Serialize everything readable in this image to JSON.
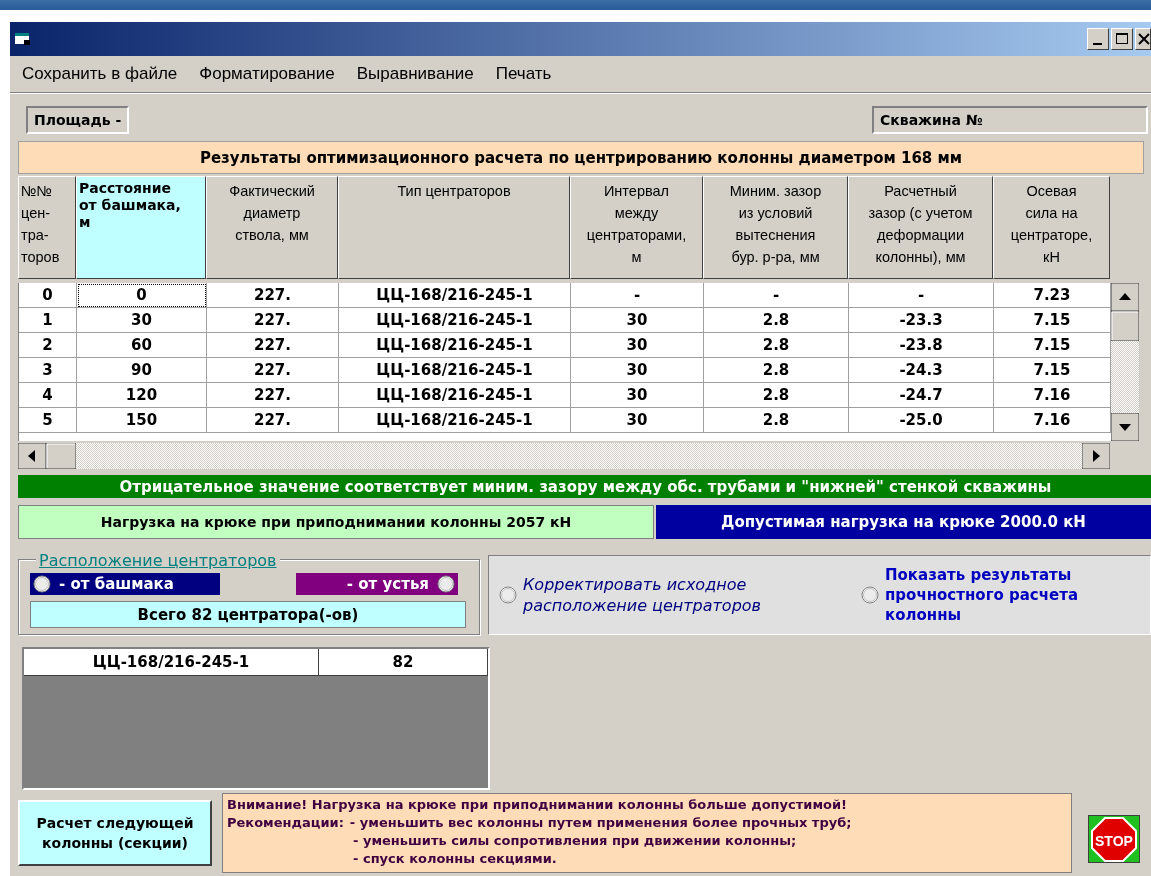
{
  "menu": [
    "Сохранить в файле",
    "Форматирование",
    "Выравнивание",
    "Печать"
  ],
  "fields": {
    "area": "Площадь -",
    "well": "Скважина №"
  },
  "results_title": "Результаты оптимизационного расчета по центрированию колонны диаметром  168 мм",
  "table": {
    "columns": [
      {
        "label": "№№\nцен-\nтра-\nторов",
        "selected": false
      },
      {
        "label": "Расстояние\nот башмака,\nм",
        "selected": true
      },
      {
        "label": "Фактический\nдиаметр\nствола, мм",
        "selected": false
      },
      {
        "label": "Тип центраторов",
        "selected": false
      },
      {
        "label": "Интервал\nмежду\nцентраторами,\nм",
        "selected": false
      },
      {
        "label": "Миним. зазор\nиз условий\nвытеснения\nбур. р-ра, мм",
        "selected": false
      },
      {
        "label": "Расчетный\nзазор (с учетом\nдеформации\nколонны), мм",
        "selected": false
      },
      {
        "label": "Осевая\nсила на\nцентраторе,\nкН",
        "selected": false
      }
    ],
    "rows": [
      [
        "0",
        "0",
        "227.",
        "ЦЦ-168/216-245-1",
        "-",
        "-",
        "-",
        "7.23"
      ],
      [
        "1",
        "30",
        "227.",
        "ЦЦ-168/216-245-1",
        "30",
        "2.8",
        "-23.3",
        "7.15"
      ],
      [
        "2",
        "60",
        "227.",
        "ЦЦ-168/216-245-1",
        "30",
        "2.8",
        "-23.8",
        "7.15"
      ],
      [
        "3",
        "90",
        "227.",
        "ЦЦ-168/216-245-1",
        "30",
        "2.8",
        "-24.3",
        "7.15"
      ],
      [
        "4",
        "120",
        "227.",
        "ЦЦ-168/216-245-1",
        "30",
        "2.8",
        "-24.7",
        "7.16"
      ],
      [
        "5",
        "150",
        "227.",
        "ЦЦ-168/216-245-1",
        "30",
        "2.8",
        "-25.0",
        "7.16"
      ]
    ]
  },
  "note": "Отрицательное значение соответствует миним. зазору между обс. трубами и \"нижней\" стенкой скважины",
  "hook_load": "Нагрузка на крюке при приподнимании колонны  2057 кН",
  "allowed_load": "Допустимая нагрузка на крюке 2000.0 кН",
  "placement": {
    "title": "Расположение центраторов",
    "options": [
      {
        "label": "- от башмака",
        "selected": false,
        "color": "#000080"
      },
      {
        "label": "- от устья",
        "selected": false,
        "color": "#800080"
      }
    ],
    "total": "Всего  82 центратора(-ов)"
  },
  "actions": [
    {
      "label": "Корректировать исходное расположение центраторов",
      "selected": false,
      "kind": "italic"
    },
    {
      "label": "Показать результаты прочностного расчета колонны",
      "selected": false,
      "kind": "bold"
    }
  ],
  "summary": [
    [
      "ЦЦ-168/216-245-1",
      "82"
    ]
  ],
  "next_button": "Расчет следующей колонны (секции)",
  "warning": {
    "heading": "Внимание! Нагрузка на крюке при приподнимании колонны больше допустимой!",
    "lead": "Рекомендации:",
    "items": [
      "- уменьшить вес колонны путем применения более прочных труб;",
      "- уменьшить силы сопротивления при движении колонны;",
      "- спуск колонны секциями."
    ]
  },
  "stop_button": "STOP"
}
